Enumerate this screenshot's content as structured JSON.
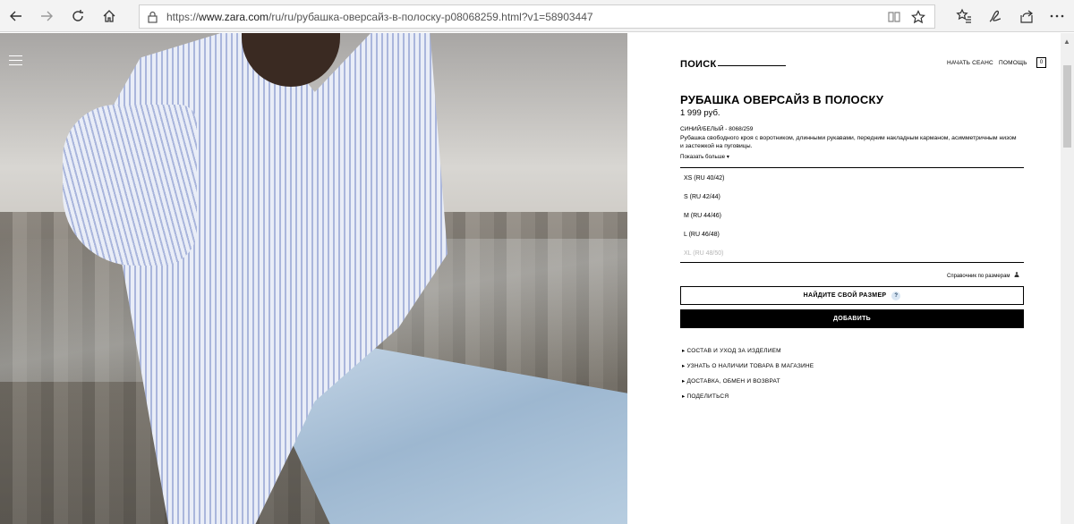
{
  "browser": {
    "url_prefix": "https://",
    "url_host": "www.zara.com",
    "url_path": "/ru/ru/рубашка-оверсайз-в-полоску-p08068259.html?v1=58903447"
  },
  "header": {
    "search": "ПОИСК",
    "login": "НАЧАТЬ СЕАНС",
    "help": "ПОМОЩЬ",
    "bag_count": "0"
  },
  "product": {
    "title": "РУБАШКА ОВЕРСАЙЗ В ПОЛОСКУ",
    "price": "1 999 руб.",
    "color": "СИНИЙ/БЕЛЫЙ - 8068/259",
    "description": "Рубашка свободного кроя с воротником, длинными рукавами, передним накладным карманом, асимметричным низом и застежкой на пуговицы.",
    "show_more": "Показать больше ▾",
    "sizes": [
      {
        "label": "XS (RU 40/42)",
        "available": true
      },
      {
        "label": "S (RU 42/44)",
        "available": true
      },
      {
        "label": "M (RU 44/46)",
        "available": true
      },
      {
        "label": "L (RU 46/48)",
        "available": true
      },
      {
        "label": "XL (RU 48/50)",
        "available": false
      }
    ],
    "size_guide": "Справочник по размерам",
    "find_size": "НАЙДИТЕ СВОЙ РАЗМЕР",
    "find_size_help": "?",
    "add": "ДОБАВИТЬ",
    "info_links": [
      "СОСТАВ И УХОД ЗА ИЗДЕЛИЕМ",
      "УЗНАТЬ О НАЛИЧИИ ТОВАРА В МАГАЗИНЕ",
      "ДОСТАВКА, ОБМЕН И ВОЗВРАТ",
      "ПОДЕЛИТЬСЯ"
    ]
  },
  "colors": {
    "accent": "#000000",
    "disabled": "#b5b5b5",
    "shirt_stripe": "#aab6dc"
  }
}
